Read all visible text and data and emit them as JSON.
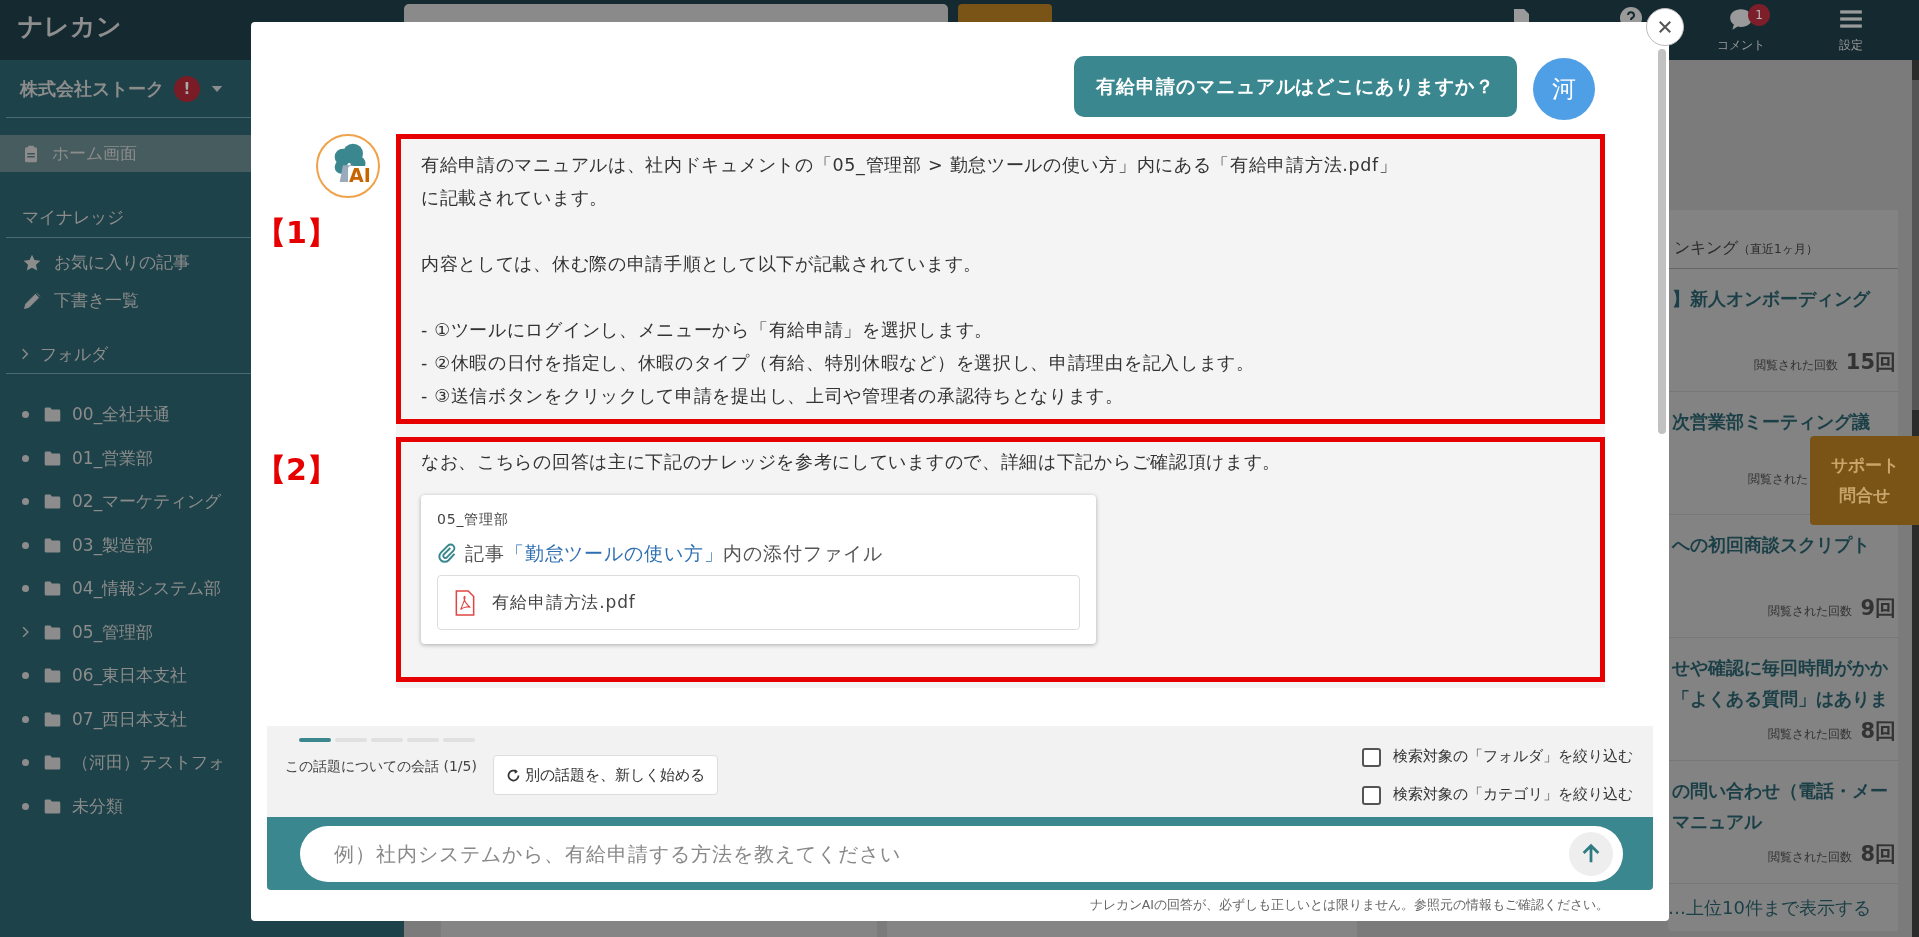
{
  "topbar": {
    "logo": "ナレカン",
    "icons": [
      {
        "kind": "document"
      },
      {
        "kind": "help"
      },
      {
        "kind": "comment",
        "label": "コメント",
        "badge": "1"
      },
      {
        "kind": "settings",
        "label": "設定"
      }
    ]
  },
  "sidebar": {
    "company": "株式会社ストーク",
    "alert": "!",
    "items": [
      {
        "kind": "clipboard",
        "label": "ホーム画面",
        "selected": true
      }
    ],
    "my_knowledge": {
      "title": "マイナレッジ",
      "items": [
        {
          "kind": "star",
          "label": "お気に入りの記事",
          "selected": false
        },
        {
          "kind": "pencil",
          "label": "下書き一覧",
          "selected": false
        }
      ]
    },
    "folders": {
      "title": "フォルダ",
      "items": [
        {
          "label": "00_全社共通",
          "expandable": false
        },
        {
          "label": "01_営業部",
          "expandable": false
        },
        {
          "label": "02_マーケティング",
          "expandable": false
        },
        {
          "label": "03_製造部",
          "expandable": false
        },
        {
          "label": "04_情報システム部",
          "expandable": false
        },
        {
          "label": "05_管理部",
          "expandable": true
        },
        {
          "label": "06_東日本支社",
          "expandable": false
        },
        {
          "label": "07_西日本支社",
          "expandable": false
        },
        {
          "label": "（河田）テストフォ",
          "expandable": false
        },
        {
          "label": "未分類",
          "expandable": false
        }
      ]
    }
  },
  "ranking": {
    "title": "ンキング",
    "period": "（直近1ヶ月）",
    "items": [
      {
        "lines": [
          "】新人オンボーディング"
        ],
        "views_label": "閲覧された回数",
        "count": "15回"
      },
      {
        "lines": [
          "次営業部ミーティング議"
        ],
        "views_label": "閲覧された"
      },
      {
        "lines": [
          "への初回商談スクリプト"
        ],
        "views_label": "閲覧された回数",
        "count": "9回"
      },
      {
        "lines": [
          "せや確認に毎回時間がかか",
          "「よくある質問」はありま"
        ],
        "views_label": "閲覧された回数",
        "count": "8回"
      },
      {
        "lines": [
          "の問い合わせ（電話・メー",
          "マニュアル"
        ],
        "views_label": "閲覧された回数",
        "count": "8回"
      }
    ],
    "more": "…上位10件まで表示する"
  },
  "support_button": [
    "サポート",
    "問合せ"
  ],
  "chat": {
    "question": "有給申請のマニュアルはどこにありますか？",
    "user_avatar": "河",
    "assistant_badge": "AI",
    "answer": {
      "marker": "【1】",
      "paragraphs": [
        {
          "lines": [
            "有給申請のマニュアルは、社内ドキュメントの「05_管理部 > 勤怠ツールの使い方」内にある「有給申請方法.pdf」",
            "に記載されています。"
          ]
        },
        {
          "lines": [
            "内容としては、休む際の申請手順として以下が記載されています。"
          ]
        },
        {
          "lines": [
            "- ①ツールにログインし、メニューから「有給申請」を選択します。",
            "- ②休暇の日付を指定し、休暇のタイプ（有給、特別休暇など）を選択し、申請理由を記入します。",
            "- ③送信ボタンをクリックして申請を提出し、上司や管理者の承認待ちとなります。"
          ]
        }
      ]
    },
    "reference": {
      "marker": "【2】",
      "intro": "なお、こちらの回答は主に下記のナレッジを参考にしていますので、詳細は下記からご確認頂けます。",
      "card": {
        "folder": "05_管理部",
        "prefix": "記事",
        "article": "「勤怠ツールの使い方」",
        "suffix": "内の添付ファイル",
        "file": "有給申請方法.pdf"
      }
    },
    "progress": {
      "level": 0.2
    },
    "conversation_count": "この話題についての会話 (1/5)",
    "new_topic_button": "別の話題を、新しく始める",
    "filters": [
      {
        "label": "検索対象の「フォルダ」を絞り込む",
        "checked": false
      },
      {
        "label": "検索対象の「カテゴリ」を絞り込む",
        "checked": false
      }
    ],
    "input": {
      "placeholder": "例）社内システムから、有給申請する方法を教えてください"
    },
    "disclaimer": "ナレカンAIの回答が、必ずしも正しいとは限りません。参照元の情報もご確認ください。"
  }
}
